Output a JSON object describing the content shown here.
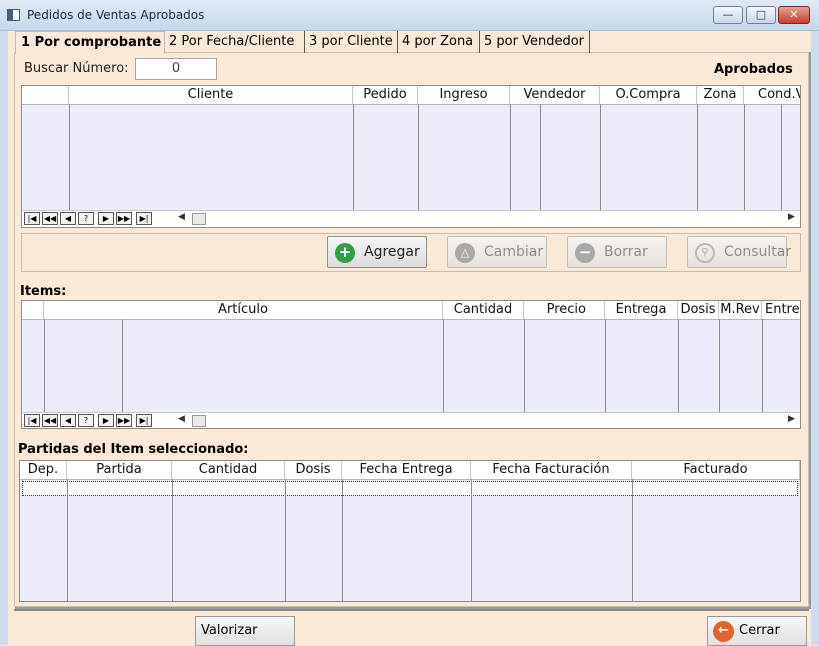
{
  "window": {
    "title": "Pedidos de Ventas Aprobados",
    "min_glyph": "—",
    "max_glyph": "□",
    "close_glyph": "✕"
  },
  "tabs": [
    {
      "label": "1 Por comprobante",
      "active": true
    },
    {
      "label": "2 Por Fecha/Cliente",
      "active": false
    },
    {
      "label": "3 por Cliente",
      "active": false
    },
    {
      "label": "4 por Zona",
      "active": false
    },
    {
      "label": "5 por Vendedor",
      "active": false
    }
  ],
  "search": {
    "label": "Buscar Número:",
    "value": "0"
  },
  "status_label": "Aprobados",
  "orders_grid": {
    "columns": [
      "",
      "Cliente",
      "Pedido",
      "Ingreso",
      "",
      "Vendedor",
      "O.Compra",
      "Zona",
      "Cond.V"
    ],
    "rows": []
  },
  "nav_buttons": [
    "|◀",
    "◀◀",
    "◀",
    "?",
    "▶",
    "▶▶",
    "▶|"
  ],
  "scroll": {
    "left": "◀",
    "right": "▶"
  },
  "actions": [
    {
      "label": "Agregar",
      "icon": "add-icon",
      "enabled": true,
      "color": "#2ea043"
    },
    {
      "label": "Cambiar",
      "icon": "change-icon",
      "enabled": false,
      "color": "#a9a9a9"
    },
    {
      "label": "Borrar",
      "icon": "delete-icon",
      "enabled": false,
      "color": "#a9a9a9"
    },
    {
      "label": "Consultar",
      "icon": "search-icon",
      "enabled": false,
      "color": "#a9a9a9"
    }
  ],
  "items": {
    "label": "Items:",
    "columns": [
      "",
      "",
      "Artículo",
      "Cantidad",
      "Precio",
      "Entrega",
      "Dosis",
      "M.Rev",
      "Entre"
    ],
    "rows": []
  },
  "partidas": {
    "label": "Partidas del Item seleccionado:",
    "columns": [
      "Dep.",
      "Partida",
      "Cantidad",
      "Dosis",
      "Fecha Entrega",
      "Fecha Facturación",
      "Facturado"
    ],
    "rows": []
  },
  "footer": {
    "valorizar": "Valorizar",
    "cerrar": "Cerrar"
  },
  "colors": {
    "panel_bg": "#fbe9d8",
    "grid_bg": "#ecedfb",
    "accent_close": "#e2622c"
  }
}
